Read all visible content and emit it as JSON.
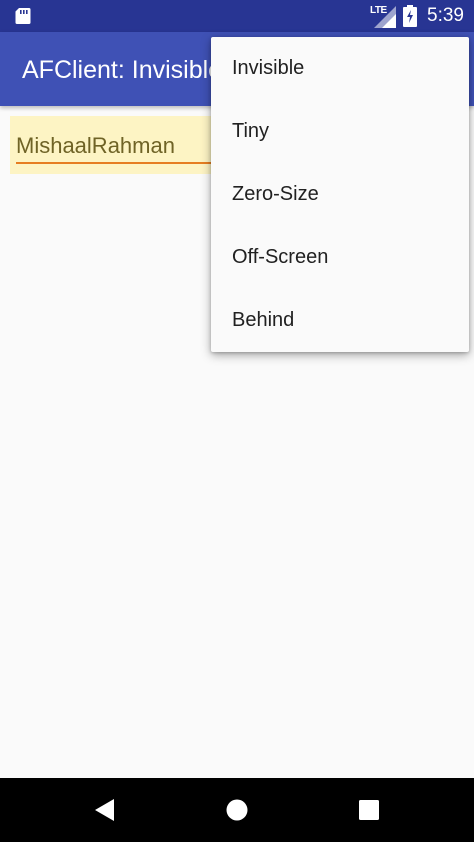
{
  "status_bar": {
    "network_label": "LTE",
    "time": "5:39",
    "icons": [
      "sd-card-icon",
      "lte-signal-icon",
      "battery-charging-icon"
    ]
  },
  "app_bar": {
    "title": "AFClient: Invisible"
  },
  "content": {
    "text_input_value": "MishaalRahman"
  },
  "popup_menu": {
    "items": [
      {
        "label": "Invisible"
      },
      {
        "label": "Tiny"
      },
      {
        "label": "Zero-Size"
      },
      {
        "label": "Off-Screen"
      },
      {
        "label": "Behind"
      }
    ]
  },
  "nav_bar": {
    "icons": [
      "back-icon",
      "home-icon",
      "recents-icon"
    ]
  },
  "colors": {
    "status_bar": "#283593",
    "app_bar": "#3f51b5",
    "input_highlight": "#fdf4c4",
    "input_underline": "#e67e22",
    "menu_background": "#fafafa",
    "nav_bar": "#000000"
  }
}
